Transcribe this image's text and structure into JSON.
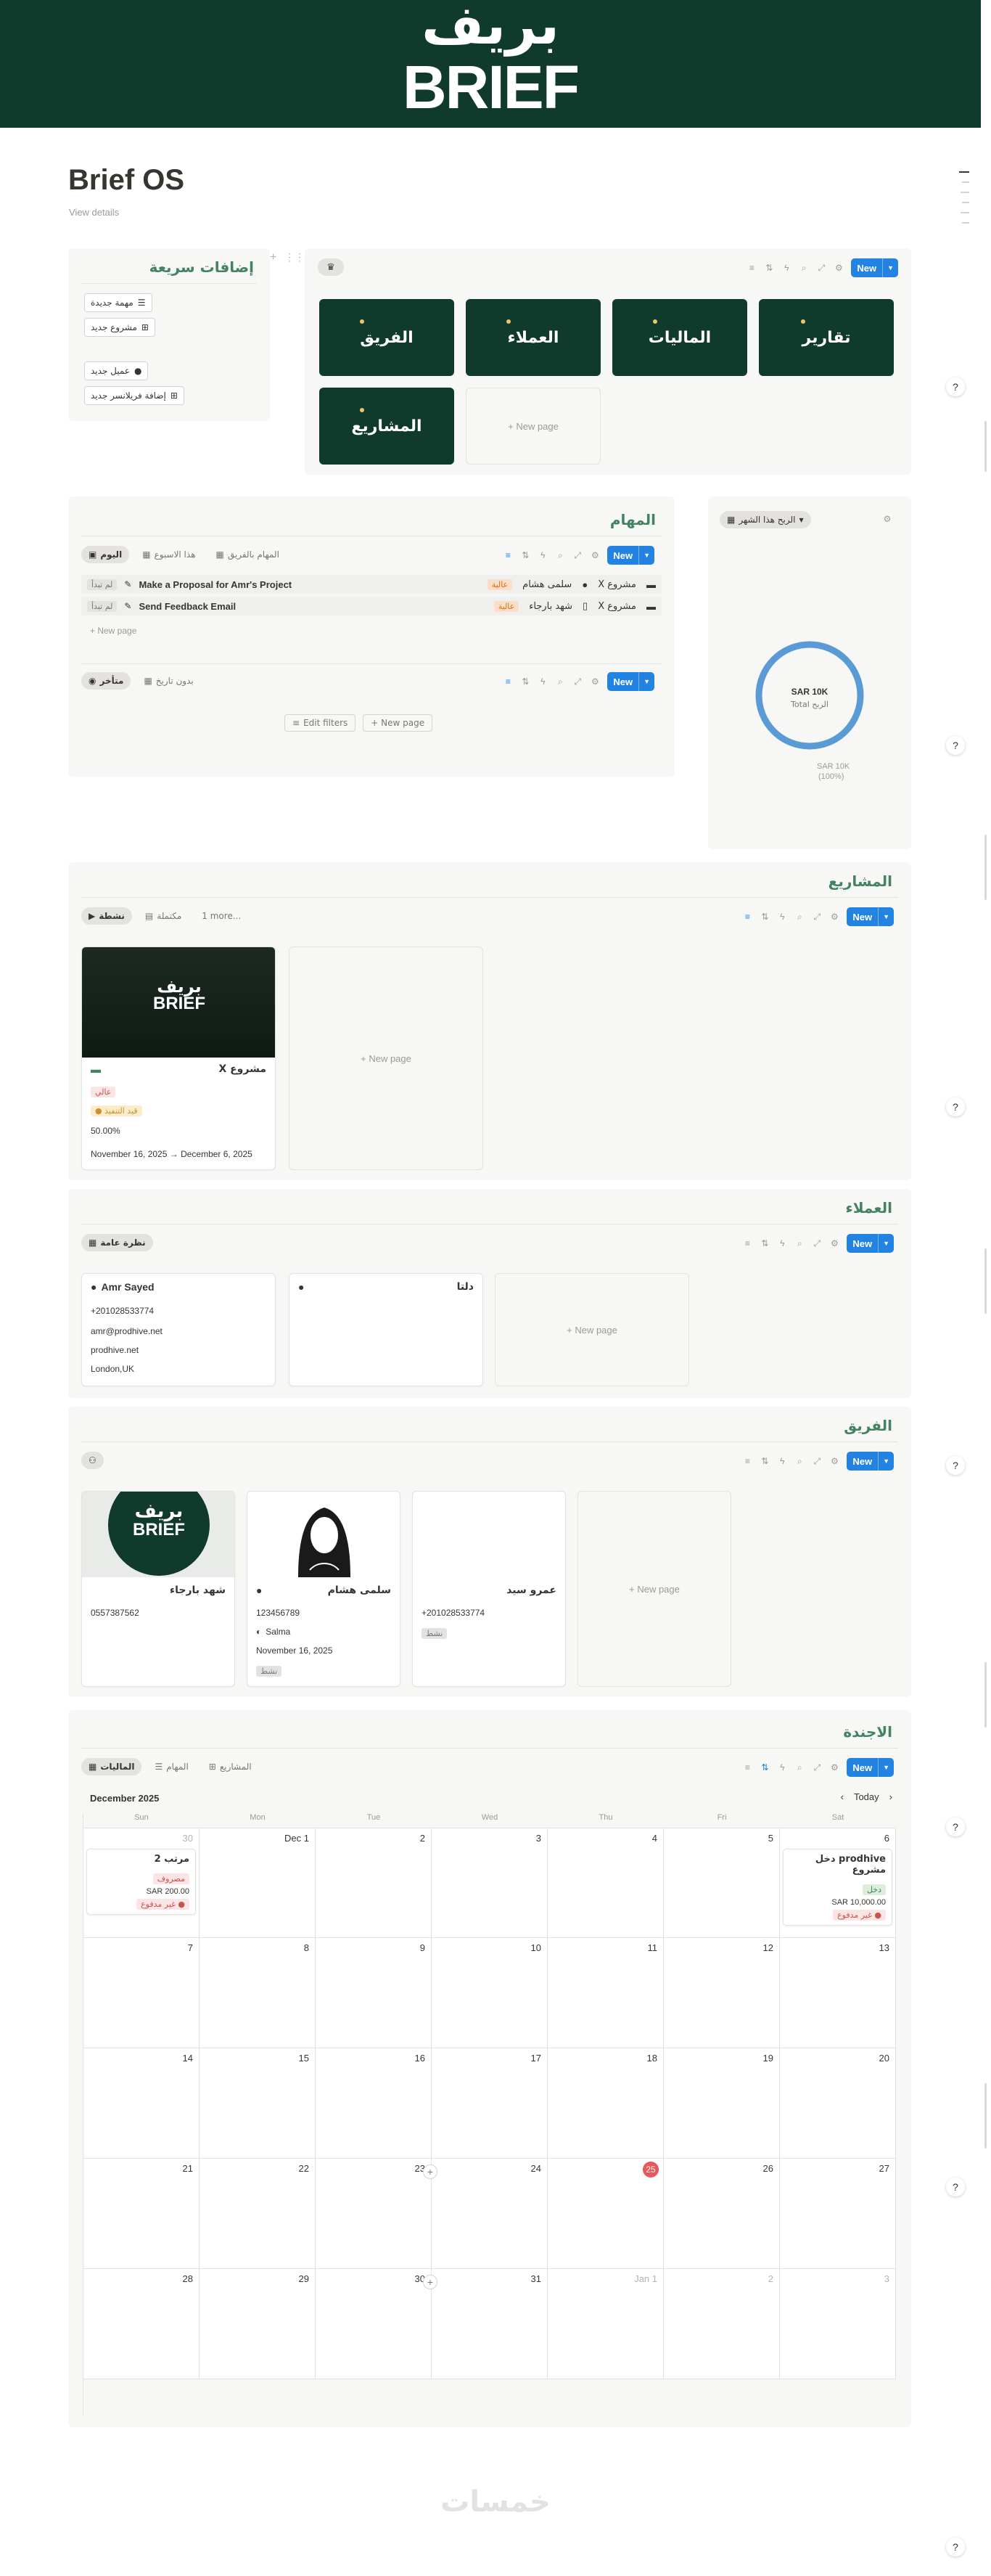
{
  "cover": {
    "logo_ar": "بريف",
    "logo_en": "BRIEF"
  },
  "page": {
    "title": "Brief OS",
    "view_details": "View details"
  },
  "quick_add": {
    "title": "إضافات سريعة",
    "buttons": [
      "مهمة جديدة",
      "مشروع جديد",
      "عميل جديد",
      "إضافة فريلانسر جديد"
    ]
  },
  "nav_tiles": {
    "tiles": [
      "تقارير",
      "الماليات",
      "العملاء",
      "الفريق",
      "المشاريع"
    ],
    "new_page": "+ New page",
    "new_label": "New"
  },
  "tasks": {
    "title": "المهام",
    "tabs": [
      "اليوم",
      "هذا الاسبوع",
      "المهام بالفريق"
    ],
    "rows": [
      {
        "project": "مشروع X",
        "assignee": "سلمى هشام",
        "priority": "عالية",
        "name": "Make a Proposal for Amr's Project",
        "status": "لم تبدأ"
      },
      {
        "project": "مشروع X",
        "assignee": "شهد بارجاء",
        "priority": "عالية",
        "name": "Send Feedback Email",
        "status": "لم تبدأ"
      }
    ],
    "new_page": "+ New page",
    "tabs2": [
      "متأخر",
      "بدون تاريخ"
    ],
    "edit_filters": "Edit filters",
    "new_page2": "+ New page",
    "new_label": "New"
  },
  "revenue": {
    "filter": "الربح هذا الشهر",
    "center_value": "SAR 10K",
    "center_label": "Total الربح",
    "legend_value": "SAR 10K",
    "legend_pct": "(100%)",
    "ring_fraction": 1.0,
    "ring_color": "#5b9bd5"
  },
  "projects": {
    "title": "المشاريع",
    "tabs": [
      "نشطة",
      "مكتملة",
      "1 more..."
    ],
    "card": {
      "cover_ar": "بريف",
      "cover_en": "BRIEF",
      "name": "مشروع X",
      "priority": "عالي",
      "status": "قيد التنفيذ",
      "progress": "50.00%",
      "dates": "November 16, 2025 → December 6, 2025"
    },
    "new_page": "+ New page",
    "new_label": "New"
  },
  "clients": {
    "title": "العملاء",
    "tab": "نظرة عامة",
    "cards": [
      {
        "name": "Amr Sayed",
        "phone": "+201028533774",
        "email": "amr@prodhive.net",
        "site": "prodhive.net",
        "location": "London,UK"
      },
      {
        "name": "دلتا"
      }
    ],
    "new_page": "+ New page",
    "new_label": "New"
  },
  "team": {
    "title": "الفريق",
    "cards": [
      {
        "name": "شهد بارجاء",
        "phone": "0557387562",
        "cover_ar": "بريف",
        "cover_en": "BRIEF"
      },
      {
        "name": "سلمى هشام",
        "phone": "123456789",
        "manager": "Salma",
        "date": "November 16, 2025",
        "status": "نشط"
      },
      {
        "name": "عمرو سيد",
        "phone": "+201028533774",
        "status": "نشط"
      }
    ],
    "new_page": "+ New page",
    "new_label": "New"
  },
  "agenda": {
    "title": "الاجندة",
    "tabs": [
      "الماليات",
      "المهام",
      "المشاريع"
    ],
    "month": "December 2025",
    "today": "Today",
    "days": [
      "Sun",
      "Mon",
      "Tue",
      "Wed",
      "Thu",
      "Fri",
      "Sat"
    ],
    "weeks": [
      [
        "30",
        "Dec 1",
        "2",
        "3",
        "4",
        "5",
        "6"
      ],
      [
        "7",
        "8",
        "9",
        "10",
        "11",
        "12",
        "13"
      ],
      [
        "14",
        "15",
        "16",
        "17",
        "18",
        "19",
        "20"
      ],
      [
        "21",
        "22",
        "23",
        "24",
        "25",
        "26",
        "27"
      ],
      [
        "28",
        "29",
        "30",
        "31",
        "Jan 1",
        "2",
        "3"
      ]
    ],
    "events": [
      {
        "title": "مرتب 2",
        "type": "مصروف",
        "amount": "SAR 200.00",
        "status": "غير مدفوع"
      },
      {
        "title": "prodhive دخل مشروع",
        "type": "دخل",
        "amount": "SAR 10,000.00",
        "status": "غير مدفوع"
      }
    ],
    "new_label": "New"
  },
  "footer": {
    "watermark": "خمسات"
  }
}
